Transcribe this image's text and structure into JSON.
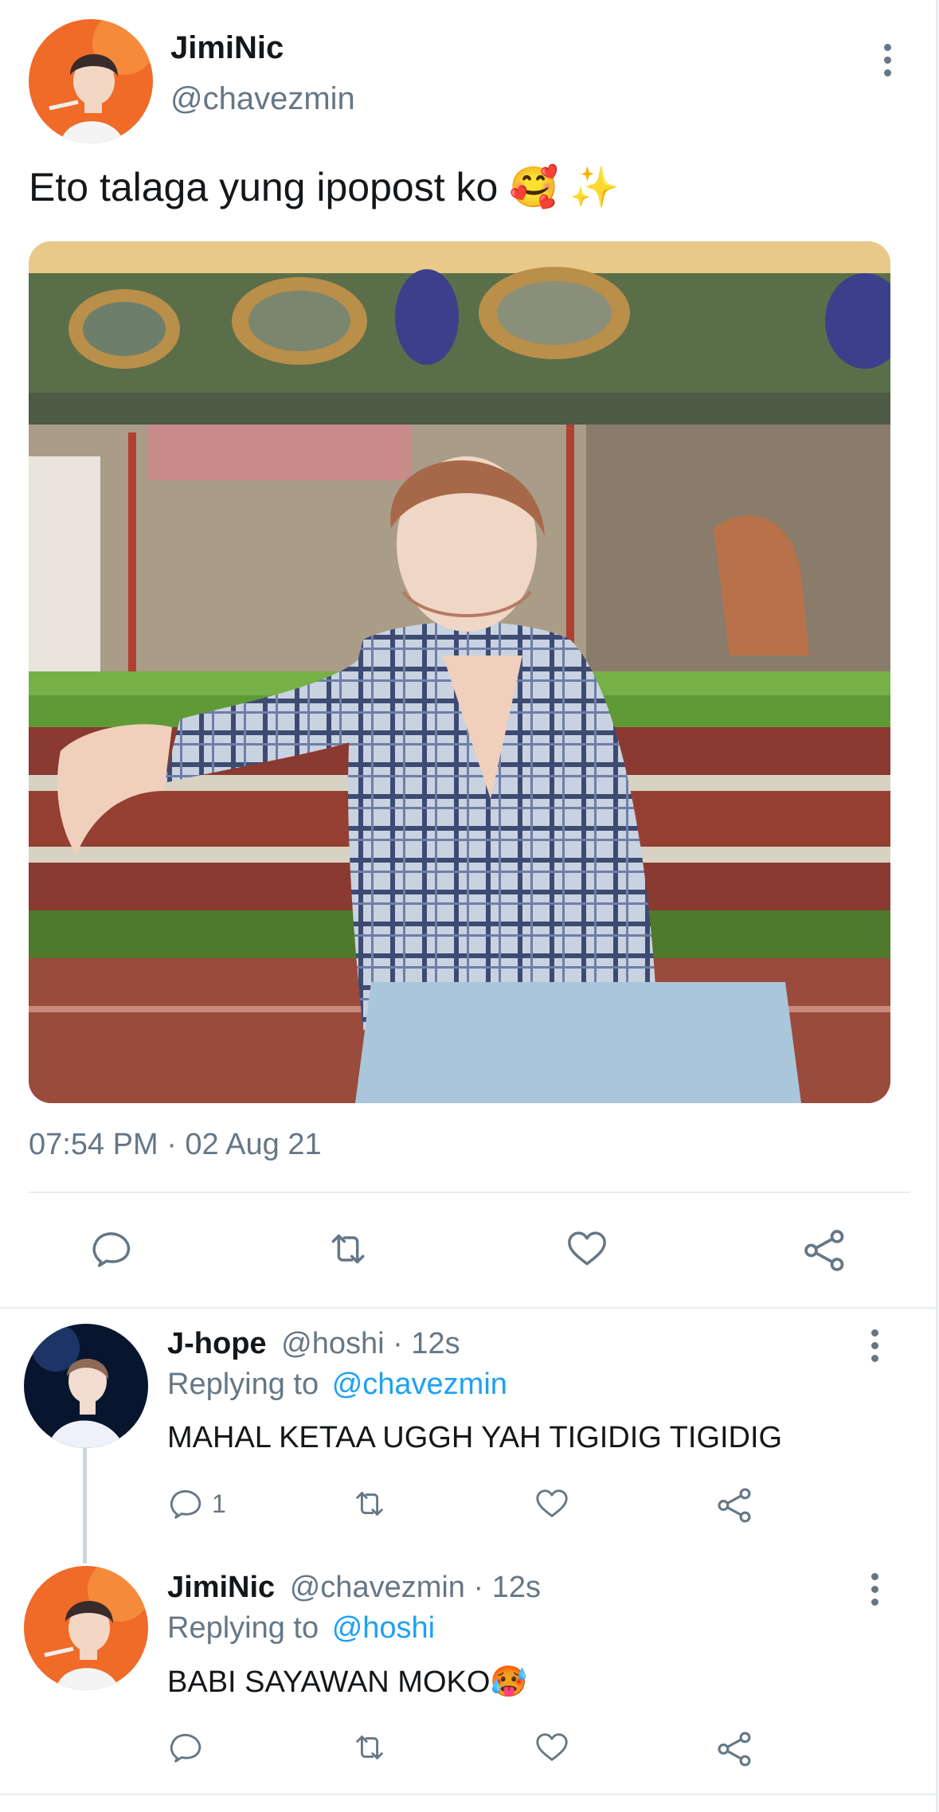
{
  "tweet": {
    "author_name": "JimiNic",
    "handle": "@chavezmin",
    "text": "Eto talaga yung ipopost ko 🥰 ✨",
    "timestamp": "07:54 PM · 02 Aug 21"
  },
  "replies": [
    {
      "author_name": "J-hope",
      "meta": "@hoshi · 12s",
      "replying_prefix": "Replying to",
      "replying_to": "@chavezmin",
      "text": "MAHAL KETAA UGGH YAH TIGIDIG TIGIDIG",
      "reply_count": "1"
    },
    {
      "author_name": "JimiNic",
      "meta": "@chavezmin · 12s",
      "replying_prefix": "Replying to",
      "replying_to": "@hoshi",
      "text": "BABI SAYAWAN MOKO🥵",
      "reply_count": ""
    }
  ],
  "icons": [
    "more-vertical-icon",
    "reply-icon",
    "retweet-icon",
    "like-icon",
    "share-icon"
  ],
  "colors": {
    "link": "#1da1f2",
    "muted": "#657786",
    "divider": "#e6ecf0",
    "avatar_orange": "#f06a28"
  }
}
